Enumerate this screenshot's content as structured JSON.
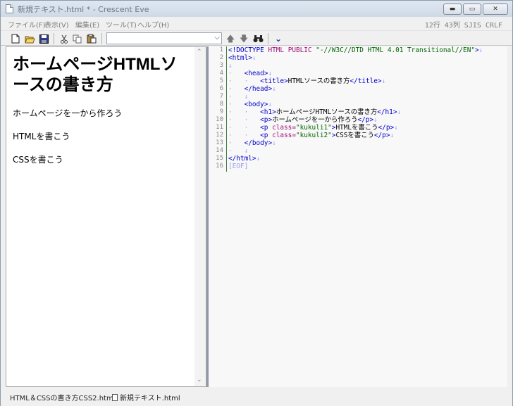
{
  "window": {
    "title": "新規テキスト.html * - Crescent Eve",
    "buttons": {
      "minimize": "▬",
      "maximize": "▭",
      "close": "✕"
    }
  },
  "menu": {
    "items": [
      "ファイル(F)",
      "表示(V)",
      "編集(E)",
      "ツール(T)",
      "ヘルプ(H)"
    ],
    "status": "12行 43列 SJIS  CRLF"
  },
  "toolbar": {
    "icons": [
      "new-file",
      "open-folder",
      "save",
      "cut",
      "copy",
      "paste",
      "up-arrow",
      "down-arrow",
      "binoculars",
      "chevron-down"
    ],
    "combo_value": ""
  },
  "preview": {
    "heading": "ホームページHTMLソースの書き方",
    "paragraphs": [
      "ホームページを一から作ろう",
      "HTMLを書こう",
      "CSSを書こう"
    ]
  },
  "editor": {
    "line_numbers": [
      "1",
      "2",
      "3",
      "4",
      "5",
      "6",
      "7",
      "8",
      "9",
      "10",
      "11",
      "12",
      "13",
      "14",
      "15",
      "16"
    ],
    "eof_marker": "[EOF]"
  },
  "statusbar": {
    "tabs": [
      "HTML＆CSSの書き方CSS2.html",
      "新規テキスト.html"
    ]
  }
}
